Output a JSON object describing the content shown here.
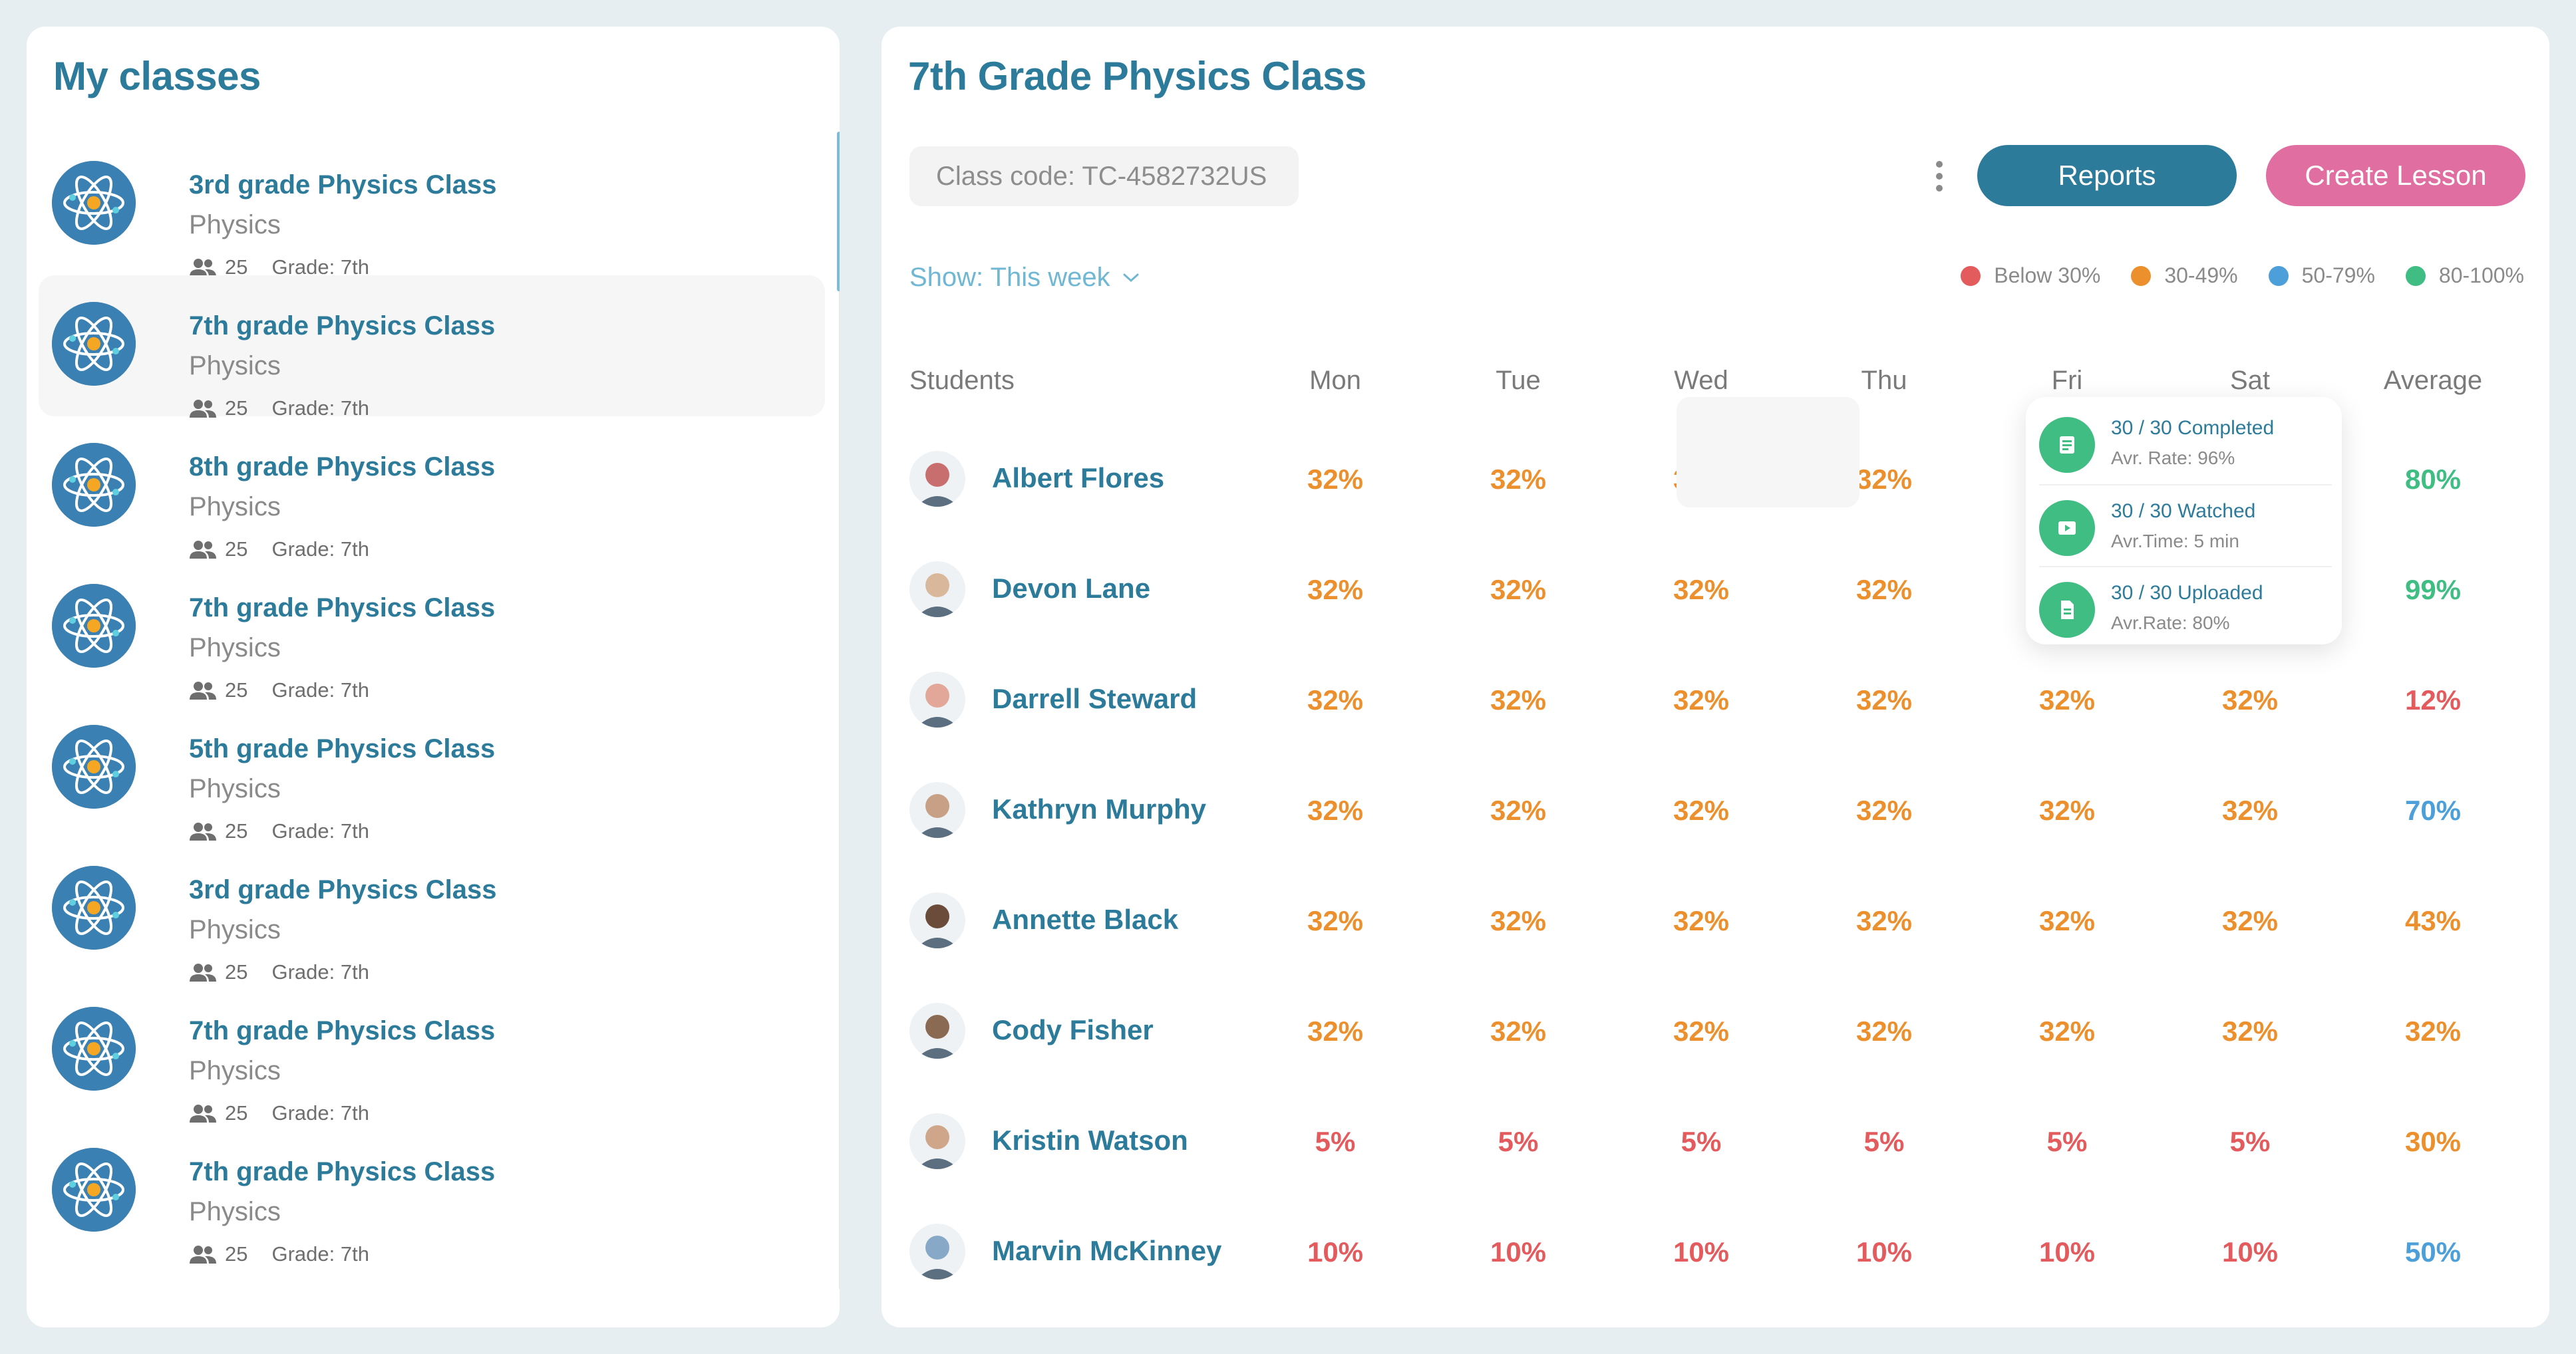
{
  "colors": {
    "below30": "#e45b5e",
    "30_49": "#ec8f2d",
    "50_79": "#4c9fd9",
    "80_100": "#3fbd83",
    "accent": "#2d7b9b",
    "pink": "#e06ea0"
  },
  "sidebar": {
    "title": "My classes",
    "items": [
      {
        "name": "3rd grade Physics Class",
        "subject": "Physics",
        "count": "25",
        "grade": "Grade: 7th"
      },
      {
        "name": "7th grade Physics Class",
        "subject": "Physics",
        "count": "25",
        "grade": "Grade: 7th"
      },
      {
        "name": "8th grade Physics Class",
        "subject": "Physics",
        "count": "25",
        "grade": "Grade: 7th"
      },
      {
        "name": "7th grade Physics Class",
        "subject": "Physics",
        "count": "25",
        "grade": "Grade: 7th"
      },
      {
        "name": "5th grade Physics Class",
        "subject": "Physics",
        "count": "25",
        "grade": "Grade: 7th"
      },
      {
        "name": "3rd grade Physics Class",
        "subject": "Physics",
        "count": "25",
        "grade": "Grade: 7th"
      },
      {
        "name": "7th grade Physics Class",
        "subject": "Physics",
        "count": "25",
        "grade": "Grade: 7th"
      },
      {
        "name": "7th grade Physics Class",
        "subject": "Physics",
        "count": "25",
        "grade": "Grade: 7th"
      }
    ]
  },
  "main": {
    "title": "7th Grade Physics Class",
    "class_code": "Class code: TC-4582732US",
    "reports_label": "Reports",
    "create_label": "Create Lesson",
    "show_label": "Show: This week",
    "legend": [
      "Below 30%",
      "30-49%",
      "50-79%",
      "80-100%"
    ],
    "headers": [
      "Students",
      "Mon",
      "Tue",
      "Wed",
      "Thu",
      "Fri",
      "Sat",
      "Average"
    ],
    "rows": [
      {
        "name": "Albert Flores",
        "values": [
          "32%",
          "32%",
          "32%",
          "32%",
          "",
          "",
          "80%"
        ]
      },
      {
        "name": "Devon Lane",
        "values": [
          "32%",
          "32%",
          "32%",
          "32%",
          "",
          "",
          "99%"
        ]
      },
      {
        "name": "Darrell Steward",
        "values": [
          "32%",
          "32%",
          "32%",
          "32%",
          "32%",
          "32%",
          "12%"
        ]
      },
      {
        "name": "Kathryn Murphy",
        "values": [
          "32%",
          "32%",
          "32%",
          "32%",
          "32%",
          "32%",
          "70%"
        ]
      },
      {
        "name": "Annette Black",
        "values": [
          "32%",
          "32%",
          "32%",
          "32%",
          "32%",
          "32%",
          "43%"
        ]
      },
      {
        "name": "Cody Fisher",
        "values": [
          "32%",
          "32%",
          "32%",
          "32%",
          "32%",
          "32%",
          "32%"
        ]
      },
      {
        "name": "Kristin Watson",
        "values": [
          "5%",
          "5%",
          "5%",
          "5%",
          "5%",
          "5%",
          "30%"
        ]
      },
      {
        "name": "Marvin McKinney",
        "values": [
          "10%",
          "10%",
          "10%",
          "10%",
          "10%",
          "10%",
          "50%"
        ]
      }
    ],
    "tooltip": [
      {
        "title": "30 / 30 Completed",
        "sub": "Avr. Rate: 96%"
      },
      {
        "title": "30 / 30 Watched",
        "sub": "Avr.Time: 5 min"
      },
      {
        "title": "30 / 30 Uploaded",
        "sub": "Avr.Rate: 80%"
      }
    ]
  }
}
